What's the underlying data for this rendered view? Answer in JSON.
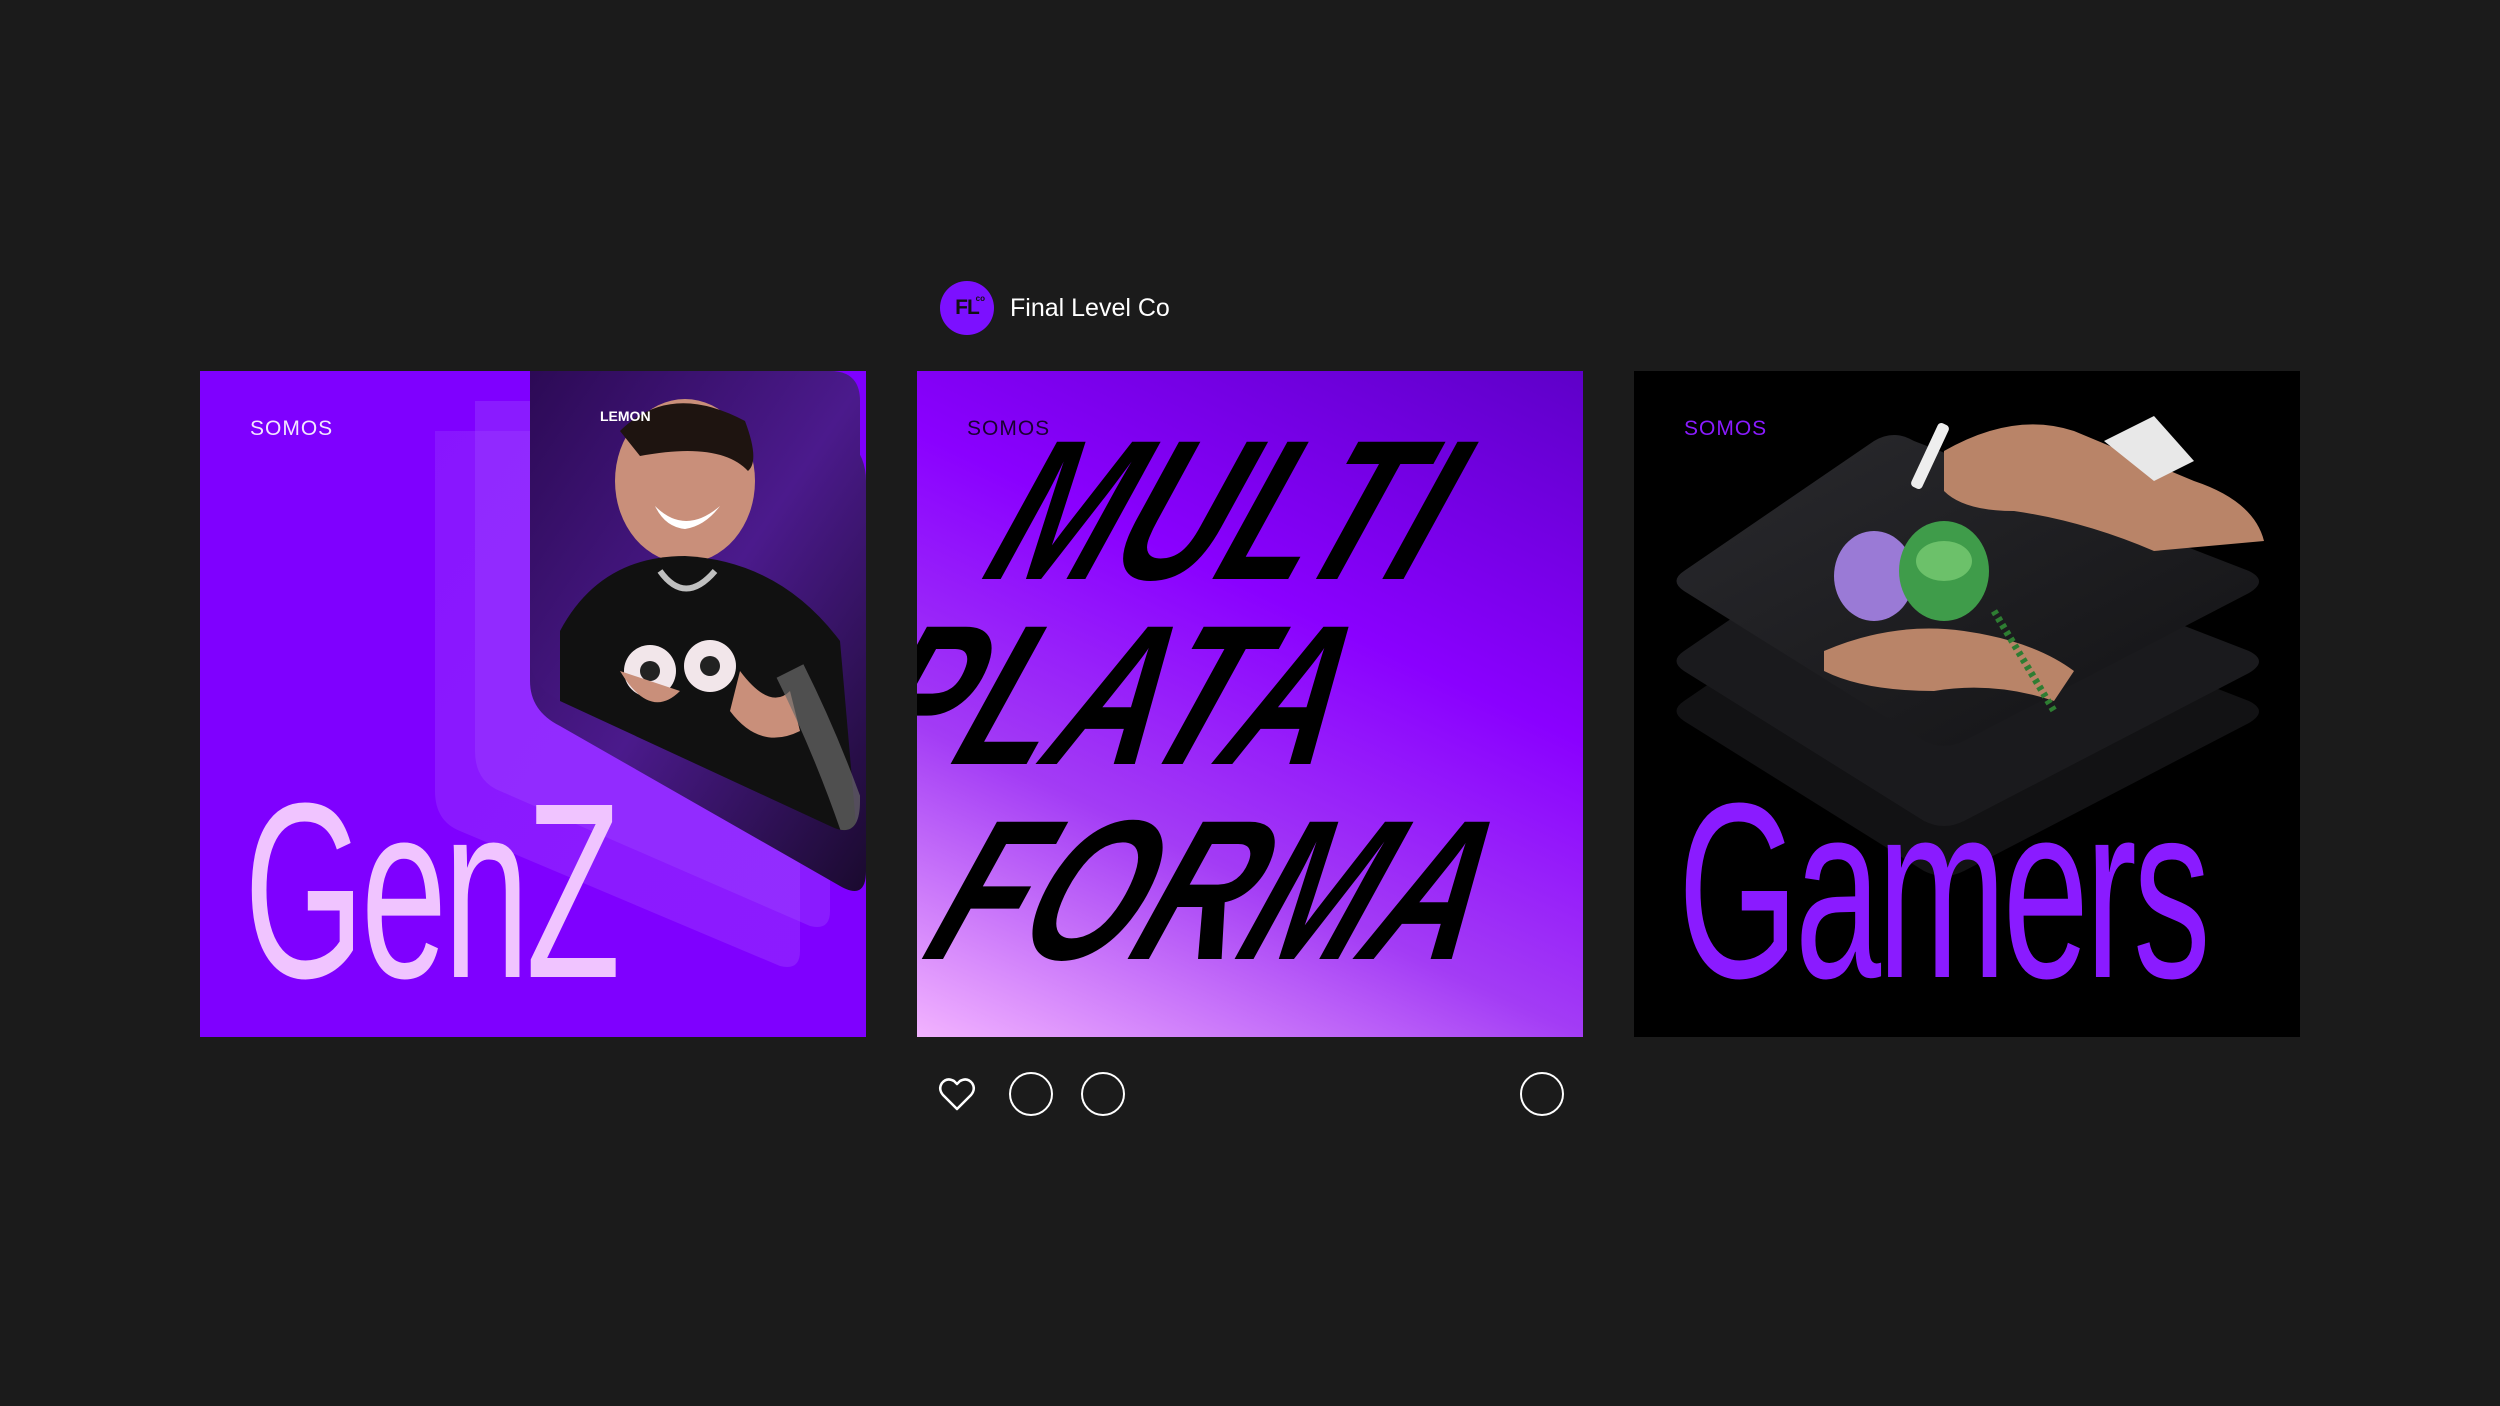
{
  "post": {
    "account_name": "Final Level Co",
    "avatar": {
      "logo_text": "FL",
      "logo_sup": "co",
      "color": "#7c10ff"
    }
  },
  "carousel": [
    {
      "label": "SOMOS",
      "word": "GenZ",
      "background": "#7f00ff",
      "word_color": "#f0c4ff"
    },
    {
      "label": "SOMOS",
      "words": [
        "MULTI",
        "PLATA",
        "FORMA"
      ],
      "background": "gradient",
      "word_color": "#000000"
    },
    {
      "label": "SOMOS",
      "word": "Gamers",
      "background": "#000000",
      "word_color": "#8a1bff"
    }
  ],
  "photo_text": {
    "lemon": "LEMON"
  },
  "actions": {
    "icons": [
      "heart-icon",
      "comment-icon",
      "share-icon",
      "bookmark-icon"
    ]
  }
}
